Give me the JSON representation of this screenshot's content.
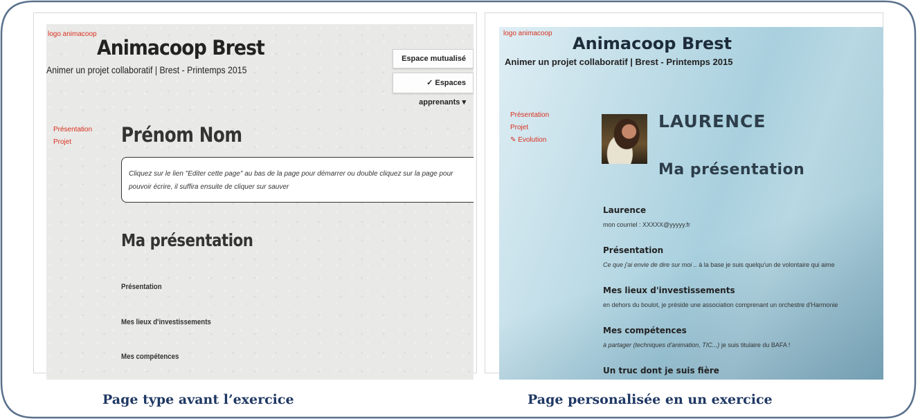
{
  "left": {
    "logo": "logo animacoop",
    "title": "Animacoop Brest",
    "subtitle": "Animer un projet collaboratif | Brest - Printemps 2015",
    "btn_mutualise": "Espace mutualisé",
    "btn_apprenants": "✓ Espaces apprenants ▾",
    "nav": [
      "Présentation",
      "Projet"
    ],
    "heading": "Prénom Nom",
    "note": "Cliquez sur le lien \"Editer cette page\" au bas de la page pour démarrer ou double cliquez sur la page pour pouvoir écrire, il suffira ensuite de cliquer sur sauver",
    "section_title": "Ma présentation",
    "items": [
      "Présentation",
      "Mes lieux d'investissements",
      "Mes compétences"
    ]
  },
  "right": {
    "logo": "logo animacoop",
    "title": "Animacoop Brest",
    "subtitle": "Animer un projet collaboratif | Brest - Printemps 2015",
    "nav": [
      "Présentation",
      "Projet",
      "✎ Evolution"
    ],
    "name": "LAURENCE",
    "section_title": "Ma présentation",
    "fields": [
      {
        "label": "Laurence",
        "text_italic": "",
        "text": "mon courriel : XXXXX@yyyyy.fr"
      },
      {
        "label": "Présentation",
        "text_italic": "Ce que j'ai envie de dire sur moi ..",
        "text": " à la base je suis quelqu'un de volontaire qui aime"
      },
      {
        "label": "Mes lieux d'investissements",
        "text_italic": "",
        "text": "en dehors du boulot, je préside une association comprenant un orchestre d'Harmonie"
      },
      {
        "label": "Mes compétences",
        "text_italic": "à partager (techniques d'animation, TIC...)",
        "text": " je suis titulaire du BAFA !"
      },
      {
        "label": "Un truc dont je suis fière",
        "text_italic": "",
        "text": ""
      }
    ]
  },
  "captions": {
    "left": "Page type avant l’exercice",
    "right": "Page personalisée en un exercice"
  },
  "colors": {
    "frame": "#5a708c",
    "caption": "#1f3864",
    "link": "#d93020"
  }
}
